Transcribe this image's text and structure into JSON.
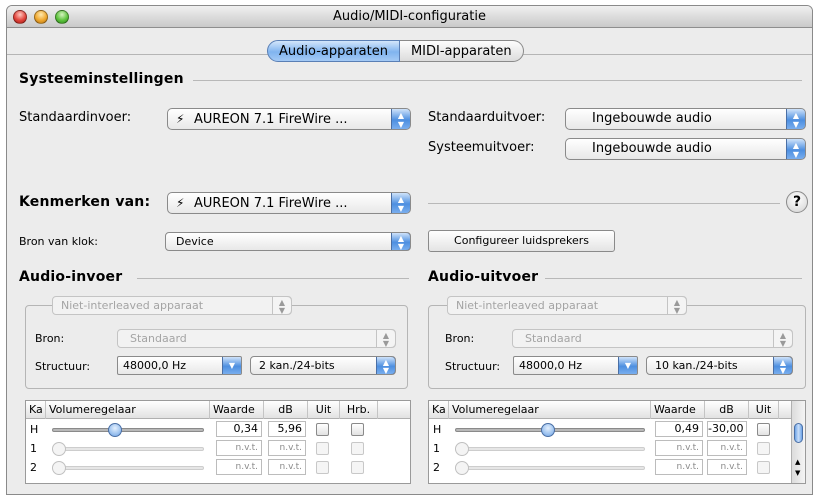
{
  "window": {
    "title": "Audio/MIDI-configuratie"
  },
  "tabs": [
    {
      "label": "Audio-apparaten",
      "selected": true
    },
    {
      "label": "MIDI-apparaten",
      "selected": false
    }
  ],
  "system_settings": {
    "title": "Systeeminstellingen",
    "default_input_label": "Standaardinvoer:",
    "default_input_value": "AUREON 7.1 FireWire ...",
    "default_output_label": "Standaarduitvoer:",
    "default_output_value": "Ingebouwde audio",
    "system_output_label": "Systeemuitvoer:",
    "system_output_value": "Ingebouwde audio"
  },
  "properties": {
    "label": "Kenmerken van:",
    "device_value": "AUREON 7.1 FireWire ...",
    "help_label": "?",
    "clock_label": "Bron van klok:",
    "clock_value": "Device",
    "configure_button": "Configureer luidsprekers"
  },
  "audio_input": {
    "title": "Audio-invoer",
    "interleave_value": "Niet-interleaved apparaat",
    "source_label": "Bron:",
    "source_value": "Standaard",
    "format_label": "Structuur:",
    "sample_rate": "48000,0 Hz",
    "channels_format": "2 kan./24-bits",
    "columns": [
      "Ka",
      "Volumeregelaar",
      "Waarde",
      "dB",
      "Uit",
      "Hrb."
    ],
    "rows": [
      {
        "channel": "H",
        "slider": 0.34,
        "value": "0,34",
        "db": "5,96",
        "enabled": true
      },
      {
        "channel": "1",
        "slider": 0,
        "value": "n.v.t.",
        "db": "n.v.t.",
        "enabled": false
      },
      {
        "channel": "2",
        "slider": 0,
        "value": "n.v.t.",
        "db": "n.v.t.",
        "enabled": false
      }
    ]
  },
  "audio_output": {
    "title": "Audio-uitvoer",
    "interleave_value": "Niet-interleaved apparaat",
    "source_label": "Bron:",
    "source_value": "Standaard",
    "format_label": "Structuur:",
    "sample_rate": "48000,0 Hz",
    "channels_format": "10 kan./24-bits",
    "columns": [
      "Ka",
      "Volumeregelaar",
      "Waarde",
      "dB",
      "Uit"
    ],
    "rows": [
      {
        "channel": "H",
        "slider": 0.49,
        "value": "0,49",
        "db": "-30,00",
        "enabled": true
      },
      {
        "channel": "1",
        "slider": 0,
        "value": "n.v.t.",
        "db": "n.v.t.",
        "enabled": false
      },
      {
        "channel": "2",
        "slider": 0,
        "value": "n.v.t.",
        "db": "n.v.t.",
        "enabled": false
      }
    ]
  },
  "icons": {
    "firewire": "firewire-icon",
    "apple": "apple-icon"
  },
  "colors": {
    "accent": "#4d8fe0",
    "window_bg": "#ececec"
  }
}
